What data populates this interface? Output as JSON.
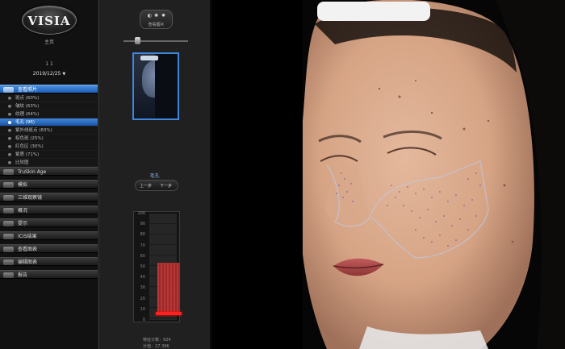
{
  "app": {
    "logo": "VISIA",
    "home": "主页"
  },
  "sidebar": {
    "counter": "1 1",
    "date": "2019/12/25",
    "active_section": "查看照片",
    "items": [
      {
        "label": "斑点 (60%)"
      },
      {
        "label": "皱纹 (63%)"
      },
      {
        "label": "纹理 (64%)"
      },
      {
        "label": "毛孔 (96)",
        "active": true
      },
      {
        "label": "紫外线斑点 (83%)"
      },
      {
        "label": "棕色斑 (25%)"
      },
      {
        "label": "红色区 (30%)"
      },
      {
        "label": "紫质 (71%)"
      },
      {
        "label": "比较图"
      }
    ],
    "sections": [
      {
        "label": "TruSkin Age"
      },
      {
        "label": "模拟"
      },
      {
        "label": "三维观察镜"
      },
      {
        "label": "概况"
      },
      {
        "label": "提示"
      },
      {
        "label": "ICIS结果"
      },
      {
        "label": "查看图表"
      },
      {
        "label": "编辑图表"
      },
      {
        "label": "报告"
      }
    ]
  },
  "panel": {
    "tools_label": "查看图片",
    "mode_label": "毛孔",
    "prev": "上一步",
    "next": "下一步",
    "meter": {
      "ticks": [
        "100",
        "90",
        "80",
        "70",
        "60",
        "50",
        "40",
        "30",
        "20",
        "10",
        "0"
      ],
      "value_percent": 48
    },
    "stats": {
      "count_label": "特征计数：",
      "count": "924",
      "score_label": "分值：",
      "score": "27.396"
    }
  },
  "colors": {
    "accent": "#3f86dc",
    "meter": "#d33a3a"
  }
}
